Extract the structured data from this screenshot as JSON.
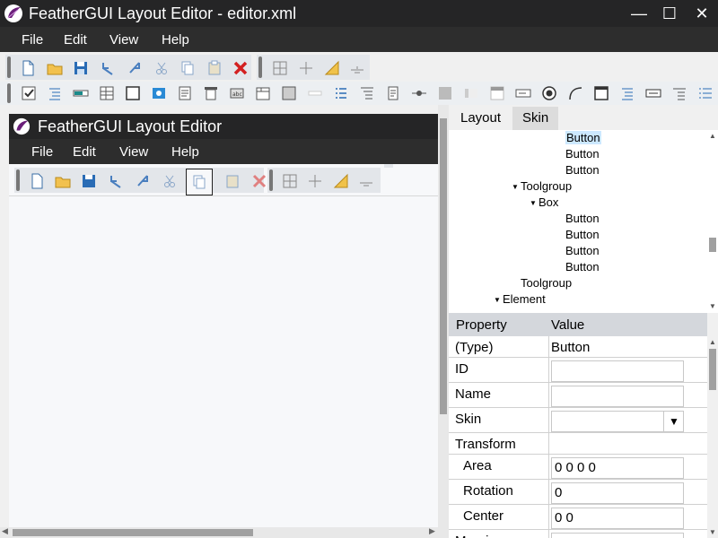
{
  "window": {
    "title": "FeatherGUI Layout Editor - editor.xml",
    "minimize": "—",
    "maximize": "☐",
    "close": "✕"
  },
  "menu": [
    "File",
    "Edit",
    "View",
    "Help"
  ],
  "preview": {
    "title": "FeatherGUI Layout Editor",
    "menu": [
      "File",
      "Edit",
      "View",
      "Help"
    ]
  },
  "tabs": {
    "layout": "Layout",
    "skin": "Skin"
  },
  "tree": [
    {
      "label": "Button",
      "depth": 3,
      "selected": true
    },
    {
      "label": "Button",
      "depth": 3
    },
    {
      "label": "Button",
      "depth": 3
    },
    {
      "label": "Toolgroup",
      "depth": 1,
      "expanded": true
    },
    {
      "label": "Box",
      "depth": 2,
      "expanded": true
    },
    {
      "label": "Button",
      "depth": 3
    },
    {
      "label": "Button",
      "depth": 3
    },
    {
      "label": "Button",
      "depth": 3
    },
    {
      "label": "Button",
      "depth": 3
    },
    {
      "label": "Toolgroup",
      "depth": 1
    },
    {
      "label": "Element",
      "depth": 0,
      "expanded": true
    }
  ],
  "properties": {
    "header": {
      "name": "Property",
      "value": "Value"
    },
    "rows": [
      {
        "name": "(Type)",
        "value": "Button",
        "kind": "static"
      },
      {
        "name": "ID",
        "value": "",
        "kind": "input"
      },
      {
        "name": "Name",
        "value": "",
        "kind": "input"
      },
      {
        "name": "Skin",
        "value": "",
        "kind": "select"
      },
      {
        "name": "Transform",
        "value": "",
        "kind": "group"
      },
      {
        "name": "Area",
        "value": "0 0 0 0",
        "kind": "input",
        "indent": true
      },
      {
        "name": "Rotation",
        "value": "0",
        "kind": "input",
        "indent": true
      },
      {
        "name": "Center",
        "value": "0 0",
        "kind": "input",
        "indent": true
      },
      {
        "name": "Margin",
        "value": "",
        "kind": "input"
      }
    ]
  },
  "colors": {
    "titlebar": "#252526",
    "menubar": "#2d2d2d",
    "selection": "#cce8ff",
    "accent": "#7b2c8c"
  }
}
